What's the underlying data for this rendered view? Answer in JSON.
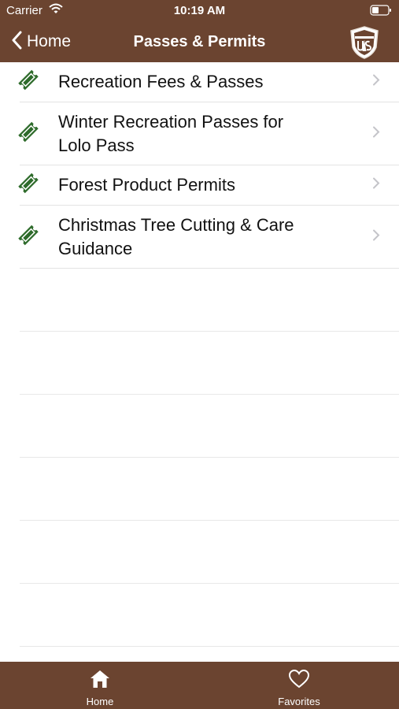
{
  "status_bar": {
    "carrier": "Carrier",
    "time": "10:19 AM"
  },
  "nav": {
    "back_label": "Home",
    "title": "Passes & Permits"
  },
  "items": [
    {
      "label": "Recreation Fees & Passes"
    },
    {
      "label": "Winter Recreation Passes for Lolo Pass"
    },
    {
      "label": "Forest Product Permits"
    },
    {
      "label": "Christmas Tree Cutting & Care Guidance"
    }
  ],
  "tabs": [
    {
      "label": "Home",
      "icon": "home-icon"
    },
    {
      "label": "Favorites",
      "icon": "heart-icon"
    }
  ],
  "colors": {
    "brand_brown": "#6b4430",
    "icon_green": "#2e6b2b"
  }
}
